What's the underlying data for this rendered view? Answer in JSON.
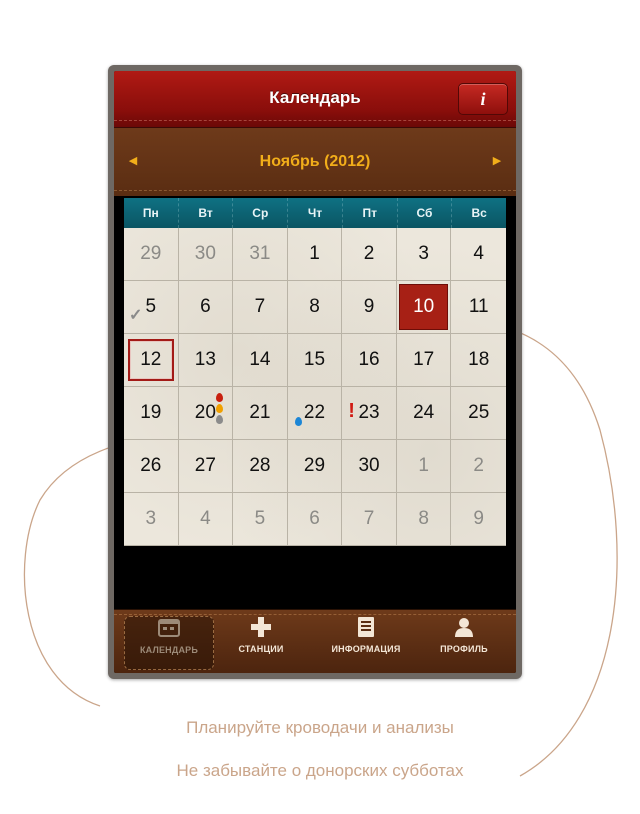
{
  "header": {
    "title": "Календарь",
    "info_label": "i"
  },
  "month_bar": {
    "title": "Ноябрь (2012)",
    "prev_arrow": "◀",
    "next_arrow": "▶"
  },
  "weekdays": [
    "Пн",
    "Вт",
    "Ср",
    "Чт",
    "Пт",
    "Сб",
    "Вс"
  ],
  "days": [
    "29",
    "30",
    "31",
    "1",
    "2",
    "3",
    "4",
    "5",
    "6",
    "7",
    "8",
    "9",
    "10",
    "11",
    "12",
    "13",
    "14",
    "15",
    "16",
    "17",
    "18",
    "19",
    "20",
    "21",
    "22",
    "23",
    "24",
    "25",
    "26",
    "27",
    "28",
    "29",
    "30",
    "1",
    "2",
    "3",
    "4",
    "5",
    "6",
    "7",
    "8",
    "9"
  ],
  "today_index": 14,
  "selected_index": 12,
  "tabs": [
    {
      "label": "КАЛЕНДАРЬ",
      "icon": "calendar-icon"
    },
    {
      "label": "СТАНЦИИ",
      "icon": "plus-icon"
    },
    {
      "label": "ИНФОРМАЦИЯ",
      "icon": "document-icon"
    },
    {
      "label": "ПРОФИЛЬ",
      "icon": "person-icon"
    }
  ],
  "captions": {
    "line1": "Планируйте кроводачи и анализы",
    "line2": "Не забывайте о донорских субботах"
  },
  "colors": {
    "header_red": "#9e1410",
    "month_brown": "#6a3518",
    "month_text": "#f2ae1a",
    "weekday_teal": "#0c6373",
    "caption": "#caa58a"
  }
}
